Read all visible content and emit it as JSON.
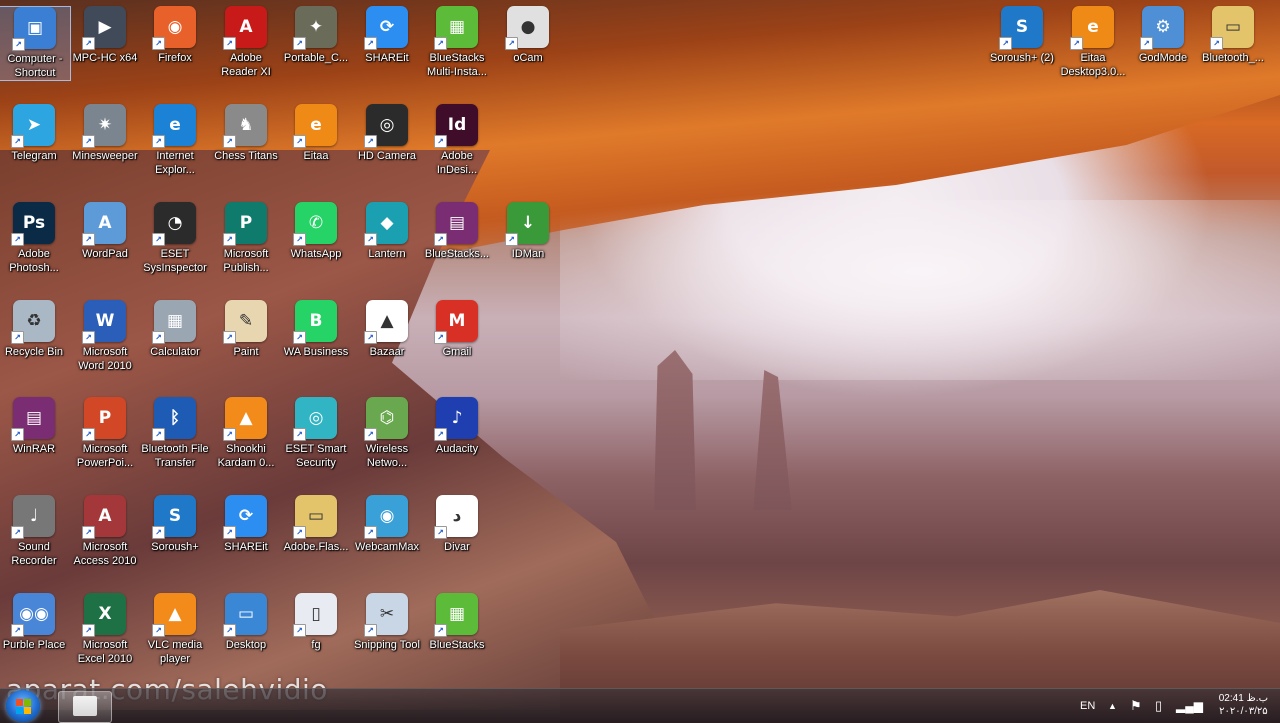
{
  "desktop": {
    "icons": [
      {
        "label": "Computer - Shortcut",
        "icon": "computer-icon",
        "color": "#3b7fd4"
      },
      {
        "label": "MPC-HC x64",
        "icon": "media-player-icon",
        "color": "#404a58"
      },
      {
        "label": "Firefox",
        "icon": "firefox-icon",
        "color": "#e8602a"
      },
      {
        "label": "Adobe Reader XI",
        "icon": "pdf-icon",
        "color": "#c91a1a"
      },
      {
        "label": "Portable_C...",
        "icon": "counter-strike-icon",
        "color": "#6b6b5a"
      },
      {
        "label": "SHAREit",
        "icon": "shareit-icon",
        "color": "#2c8ef0"
      },
      {
        "label": "BlueStacks Multi-Insta...",
        "icon": "bluestacks-icon",
        "color": "#5dbb3a"
      },
      {
        "label": "oCam",
        "icon": "ocam-icon",
        "color": "#e0e0e0"
      },
      {
        "label": "Telegram",
        "icon": "telegram-icon",
        "color": "#2ca5e0"
      },
      {
        "label": "Minesweeper",
        "icon": "mine-icon",
        "color": "#7b8590"
      },
      {
        "label": "Internet Explor...",
        "icon": "ie-icon",
        "color": "#1c82d6"
      },
      {
        "label": "Chess Titans",
        "icon": "chess-icon",
        "color": "#8a8a8a"
      },
      {
        "label": "Eitaa",
        "icon": "eitaa-icon",
        "color": "#f08a17"
      },
      {
        "label": "HD Camera",
        "icon": "camera-icon",
        "color": "#2b2b2b"
      },
      {
        "label": "Adobe InDesi...",
        "icon": "indesign-icon",
        "color": "#3f0d2a"
      },
      {
        "label": "Adobe Photosh...",
        "icon": "photoshop-icon",
        "color": "#0a2a46"
      },
      {
        "label": "WordPad",
        "icon": "wordpad-icon",
        "color": "#5d9ad8"
      },
      {
        "label": "ESET SysInspector",
        "icon": "gauge-icon",
        "color": "#2b2b2b"
      },
      {
        "label": "Microsoft Publish...",
        "icon": "publisher-icon",
        "color": "#0f7b6c"
      },
      {
        "label": "WhatsApp",
        "icon": "whatsapp-icon",
        "color": "#25d366"
      },
      {
        "label": "Lantern",
        "icon": "lantern-icon",
        "color": "#1aa0b0"
      },
      {
        "label": "BlueStacks...",
        "icon": "winrar-icon",
        "color": "#7a2d72"
      },
      {
        "label": "IDMan",
        "icon": "idm-icon",
        "color": "#3a9a3a"
      },
      {
        "label": "Recycle Bin",
        "icon": "recycle-bin-icon",
        "color": "#aab8c6"
      },
      {
        "label": "Microsoft Word 2010",
        "icon": "word-icon",
        "color": "#2b5eb8"
      },
      {
        "label": "Calculator",
        "icon": "calculator-icon",
        "color": "#9aa6b2"
      },
      {
        "label": "Paint",
        "icon": "paint-icon",
        "color": "#e7d6b0"
      },
      {
        "label": "WA Business",
        "icon": "wa-business-icon",
        "color": "#25d366"
      },
      {
        "label": "Bazaar",
        "icon": "bazaar-icon",
        "color": "#ffffff"
      },
      {
        "label": "Gmail",
        "icon": "gmail-icon",
        "color": "#d93025"
      },
      {
        "label": "WinRAR",
        "icon": "winrar-icon",
        "color": "#7a2d72"
      },
      {
        "label": "Microsoft PowerPoi...",
        "icon": "powerpoint-icon",
        "color": "#d24726"
      },
      {
        "label": "Bluetooth File Transfer",
        "icon": "bluetooth-icon",
        "color": "#1e5bb5"
      },
      {
        "label": "Shookhi Kardam 0...",
        "icon": "vlc-icon",
        "color": "#f28b1a"
      },
      {
        "label": "ESET Smart Security",
        "icon": "eset-icon",
        "color": "#31b5c4"
      },
      {
        "label": "Wireless Netwo...",
        "icon": "network-icon",
        "color": "#6aa84f"
      },
      {
        "label": "Audacity",
        "icon": "audacity-icon",
        "color": "#1f3fb0"
      },
      {
        "label": "Sound Recorder",
        "icon": "microphone-icon",
        "color": "#777777"
      },
      {
        "label": "Microsoft Access 2010",
        "icon": "access-icon",
        "color": "#a4373a"
      },
      {
        "label": "Soroush+",
        "icon": "soroush-icon",
        "color": "#1f78c8"
      },
      {
        "label": "SHAREit",
        "icon": "shareit-icon",
        "color": "#2c8ef0"
      },
      {
        "label": "Adobe.Flas...",
        "icon": "folder-icon",
        "color": "#e3c46b"
      },
      {
        "label": "WebcamMax",
        "icon": "webcam-icon",
        "color": "#39a0d8"
      },
      {
        "label": "Divar",
        "icon": "divar-icon",
        "color": "#ffffff"
      },
      {
        "label": "Purble Place",
        "icon": "eyes-icon",
        "color": "#4a86d8"
      },
      {
        "label": "Microsoft Excel 2010",
        "icon": "excel-icon",
        "color": "#1e7145"
      },
      {
        "label": "VLC media player",
        "icon": "vlc-icon",
        "color": "#f28b1a"
      },
      {
        "label": "Desktop",
        "icon": "desktop-icon",
        "color": "#3a87d6"
      },
      {
        "label": "fg",
        "icon": "file-icon",
        "color": "#e8ecf2"
      },
      {
        "label": "Snipping Tool",
        "icon": "scissors-icon",
        "color": "#c9d6e6"
      },
      {
        "label": "BlueStacks",
        "icon": "bluestacks-icon",
        "color": "#5dbb3a"
      },
      {
        "label": "Soroush+ (2)",
        "icon": "soroush-icon",
        "color": "#1f78c8"
      },
      {
        "label": "Eitaa Desktop3.0...",
        "icon": "eitaa-icon",
        "color": "#f08a17"
      },
      {
        "label": "GodMode",
        "icon": "control-panel-icon",
        "color": "#4f8fd6"
      },
      {
        "label": "Bluetooth_...",
        "icon": "folder-icon",
        "color": "#e3c46b"
      }
    ]
  },
  "watermark": "aparat.com/salehvidio",
  "taskbar": {
    "language": "EN",
    "time": "02:41 ب.ظ",
    "date": "۲۰۲۰/۰۳/۲۵"
  }
}
